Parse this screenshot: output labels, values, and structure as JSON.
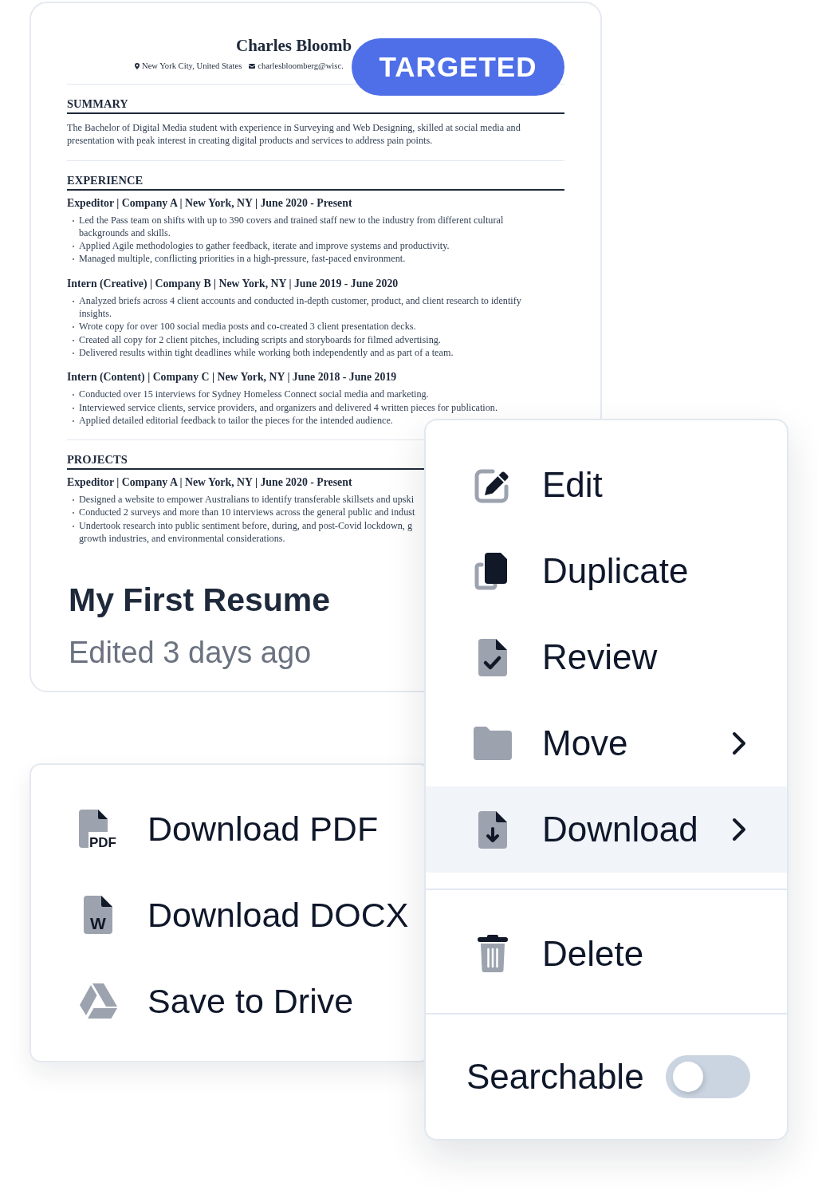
{
  "resume_card": {
    "badge": "TARGETED",
    "preview": {
      "name": "Charles Bloomb",
      "contacts": [
        {
          "kind": "location",
          "text": "New York City, United States"
        },
        {
          "kind": "email",
          "text": "charlesbloomberg@wisc."
        }
      ],
      "sections": [
        {
          "heading": "SUMMARY",
          "paragraph": "The Bachelor of Digital Media student with experience in Surveying and Web Designing, skilled at social media and\npresentation with peak interest in creating digital products and services to address pain points."
        },
        {
          "heading": "EXPERIENCE",
          "entries": [
            {
              "title": "Expeditor | Company A | New York, NY | June 2020 - Present",
              "bullets": [
                "Led the Pass team on shifts with up to 390 covers and trained staff new to the industry from different cultural\nbackgrounds and skills.",
                "Applied Agile methodologies to gather feedback, iterate and improve systems and productivity.",
                "Managed multiple, conflicting priorities in a high-pressure, fast-paced environment."
              ]
            },
            {
              "title": "Intern (Creative) | Company B | New York, NY | June 2019 - June 2020",
              "bullets": [
                "Analyzed briefs across 4 client accounts and conducted in-depth customer, product, and client research to identify\ninsights.",
                "Wrote copy for over 100 social media posts and co-created 3 client presentation decks.",
                "Created all copy for 2 client pitches, including scripts and storyboards for filmed advertising.",
                "Delivered results within tight deadlines while working both independently and as part of a team."
              ]
            },
            {
              "title": "Intern (Content) | Company C | New York, NY | June 2018 - June 2019",
              "bullets": [
                "Conducted over 15 interviews for Sydney Homeless Connect social media and marketing.",
                "Interviewed service clients, service providers, and organizers and delivered 4 written pieces for publication.",
                "Applied detailed editorial feedback to tailor the pieces for the intended audience."
              ]
            }
          ]
        },
        {
          "heading": "PROJECTS",
          "entries": [
            {
              "title": "Expeditor | Company A | New York, NY | June 2020 - Present",
              "bullets": [
                "Designed a website to empower Australians to identify transferable skillsets and upski",
                "Conducted 2 surveys and more than 10 interviews across the general public and indust",
                "Undertook research into public sentiment before, during, and post-Covid lockdown, g\ngrowth industries, and environmental considerations."
              ]
            }
          ]
        }
      ]
    },
    "title": "My First Resume",
    "subtitle": "Edited 3 days ago"
  },
  "download_menu": {
    "items": [
      {
        "label": "Download PDF",
        "icon_text": "PDF",
        "selected": false
      },
      {
        "label": "Download DOCX",
        "icon_text": "W",
        "selected": false
      },
      {
        "label": "Save to Drive",
        "selected": false
      }
    ]
  },
  "context_menu": {
    "groups": [
      {
        "items": [
          {
            "label": "Edit",
            "submenu": false,
            "selected": false
          },
          {
            "label": "Duplicate",
            "submenu": false,
            "selected": false
          },
          {
            "label": "Review",
            "submenu": false,
            "selected": false
          },
          {
            "label": "Move",
            "submenu": true,
            "selected": false
          },
          {
            "label": "Download",
            "submenu": true,
            "selected": true
          }
        ]
      },
      {
        "items": [
          {
            "label": "Delete",
            "submenu": false,
            "selected": false
          }
        ]
      }
    ],
    "toggle": {
      "label": "Searchable",
      "on": false
    }
  }
}
